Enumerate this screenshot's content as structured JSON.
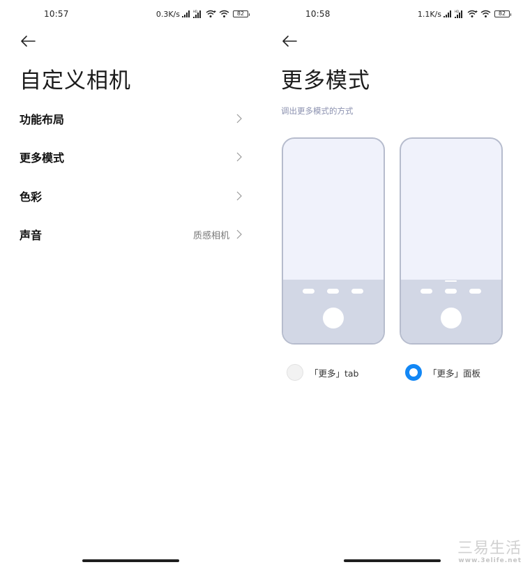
{
  "left_screen": {
    "status_bar": {
      "time": "10:57",
      "net_speed": "0.3K/s",
      "hd_badge": "HD",
      "battery": "82",
      "icons": [
        "signal-bars-icon",
        "hd-signal-bars-icon",
        "wifi-plus-icon",
        "wifi-icon",
        "battery-icon"
      ]
    },
    "back_icon": "arrow-left-icon",
    "title": "自定义相机",
    "items": [
      {
        "label": "功能布局",
        "value": "",
        "icon": "chevron-right-icon"
      },
      {
        "label": "更多模式",
        "value": "",
        "icon": "chevron-right-icon"
      },
      {
        "label": "色彩",
        "value": "",
        "icon": "chevron-right-icon"
      },
      {
        "label": "声音",
        "value": "质感相机",
        "icon": "chevron-right-icon"
      }
    ]
  },
  "right_screen": {
    "status_bar": {
      "time": "10:58",
      "net_speed": "1.1K/s",
      "hd_badge": "HD",
      "battery": "82",
      "icons": [
        "signal-bars-icon",
        "hd-signal-bars-icon",
        "wifi-plus-icon",
        "wifi-icon",
        "battery-icon"
      ]
    },
    "back_icon": "arrow-left-icon",
    "title": "更多模式",
    "subtitle": "调出更多模式的方式",
    "options": [
      {
        "label": "「更多」tab",
        "selected": false
      },
      {
        "label": "「更多」面板",
        "selected": true
      }
    ]
  },
  "colors": {
    "accent": "#1287f5",
    "subtitle": "#8c92b0",
    "phone_outline": "#b6bccd",
    "phone_screen": "#f0f2fb",
    "phone_controls": "#d2d7e5"
  },
  "watermark": {
    "text": "三易生活",
    "url": "www.3elife.net"
  }
}
